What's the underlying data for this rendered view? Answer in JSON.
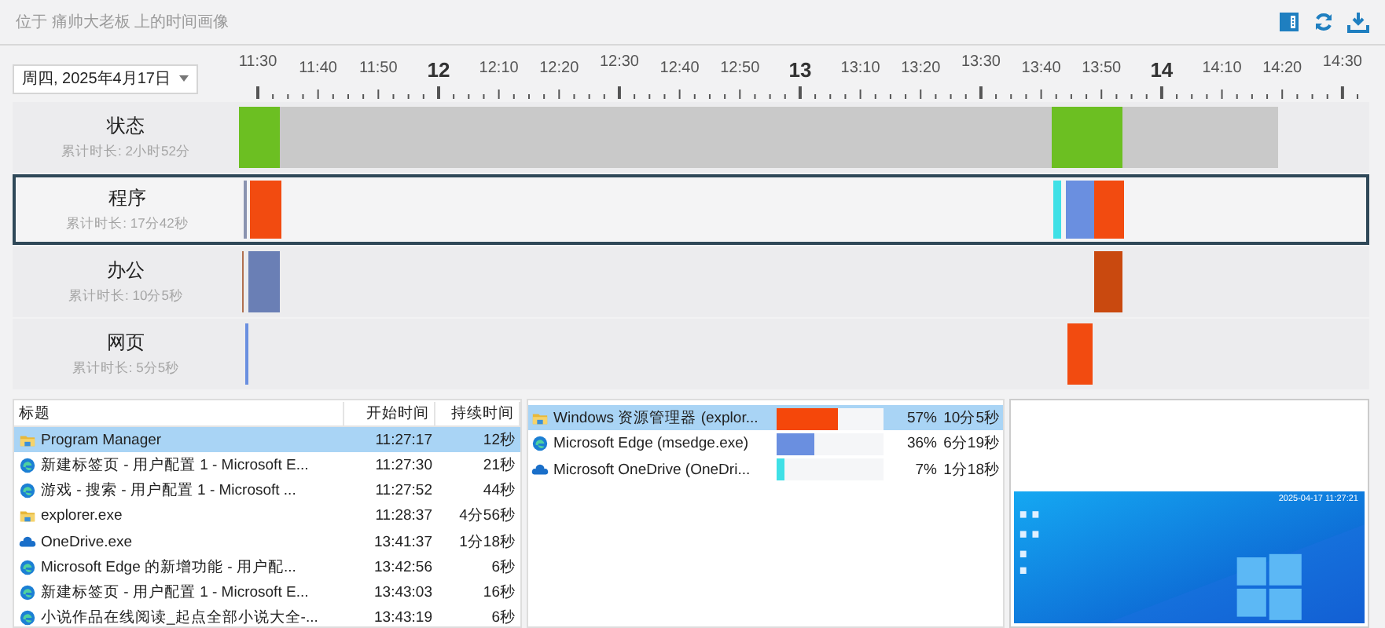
{
  "header": {
    "title": "位于 痛帅大老板 上的时间画像"
  },
  "date_picker": {
    "value": "周四, 2025年4月17日"
  },
  "axis": {
    "ticks": [
      {
        "label": "11:30",
        "kind": "half"
      },
      {
        "label": "11:40",
        "kind": "minute"
      },
      {
        "label": "11:50",
        "kind": "minute"
      },
      {
        "label": "12",
        "kind": "hour"
      },
      {
        "label": "12:10",
        "kind": "minute"
      },
      {
        "label": "12:20",
        "kind": "minute"
      },
      {
        "label": "12:30",
        "kind": "half"
      },
      {
        "label": "12:40",
        "kind": "minute"
      },
      {
        "label": "12:50",
        "kind": "minute"
      },
      {
        "label": "13",
        "kind": "hour"
      },
      {
        "label": "13:10",
        "kind": "minute"
      },
      {
        "label": "13:20",
        "kind": "minute"
      },
      {
        "label": "13:30",
        "kind": "half"
      },
      {
        "label": "13:40",
        "kind": "minute"
      },
      {
        "label": "13:50",
        "kind": "minute"
      },
      {
        "label": "14",
        "kind": "hour"
      },
      {
        "label": "14:10",
        "kind": "minute"
      },
      {
        "label": "14:20",
        "kind": "minute"
      },
      {
        "label": "14:30",
        "kind": "half"
      }
    ]
  },
  "lanes": [
    {
      "name": "状态",
      "total": "累计时长: 2小时52分",
      "selected": false
    },
    {
      "name": "程序",
      "total": "累计时长: 17分42秒",
      "selected": true
    },
    {
      "name": "办公",
      "total": "累计时长: 10分5秒",
      "selected": false
    },
    {
      "name": "网页",
      "total": "累计时长: 5分5秒",
      "selected": false
    }
  ],
  "events_table": {
    "columns": [
      "标题",
      "开始时间",
      "持续时间"
    ],
    "rows": [
      {
        "kind": "folder",
        "title": "Program Manager",
        "start": "11:27:17",
        "duration": "12秒",
        "selected": true
      },
      {
        "kind": "edge",
        "title": "新建标签页 - 用户配置 1 - Microsoft E...",
        "start": "11:27:30",
        "duration": "21秒",
        "selected": false
      },
      {
        "kind": "edge",
        "title": "游戏 - 搜索 - 用户配置 1 - Microsoft ...",
        "start": "11:27:52",
        "duration": "44秒",
        "selected": false
      },
      {
        "kind": "folder",
        "title": "explorer.exe",
        "start": "11:28:37",
        "duration": "4分56秒",
        "selected": false
      },
      {
        "kind": "cloud",
        "title": "OneDrive.exe",
        "start": "13:41:37",
        "duration": "1分18秒",
        "selected": false
      },
      {
        "kind": "edge",
        "title": "Microsoft Edge 的新增功能 - 用户配...",
        "start": "13:42:56",
        "duration": "6秒",
        "selected": false
      },
      {
        "kind": "edge",
        "title": "新建标签页 - 用户配置 1 - Microsoft E...",
        "start": "13:43:03",
        "duration": "16秒",
        "selected": false
      },
      {
        "kind": "edge",
        "title": "小说作品在线阅读_起点全部小说大全-...",
        "start": "13:43:19",
        "duration": "6秒",
        "selected": false
      }
    ]
  },
  "apps_table": {
    "rows": [
      {
        "kind": "folder",
        "name": "Windows 资源管理器 (explor...",
        "level": 0.57,
        "color": "#f5470a",
        "percent": "57%",
        "duration": "10分5秒",
        "selected": true
      },
      {
        "kind": "edge",
        "name": "Microsoft Edge (msedge.exe)",
        "level": 0.36,
        "color": "#6a8fe0",
        "percent": "36%",
        "duration": "6分19秒",
        "selected": false
      },
      {
        "kind": "cloud",
        "name": "Microsoft OneDrive (OneDri...",
        "level": 0.07,
        "color": "#3fe0e6",
        "percent": "7%",
        "duration": "1分18秒",
        "selected": false
      }
    ]
  },
  "preview": {
    "timestamp": "2025-04-17 11:27:21"
  }
}
